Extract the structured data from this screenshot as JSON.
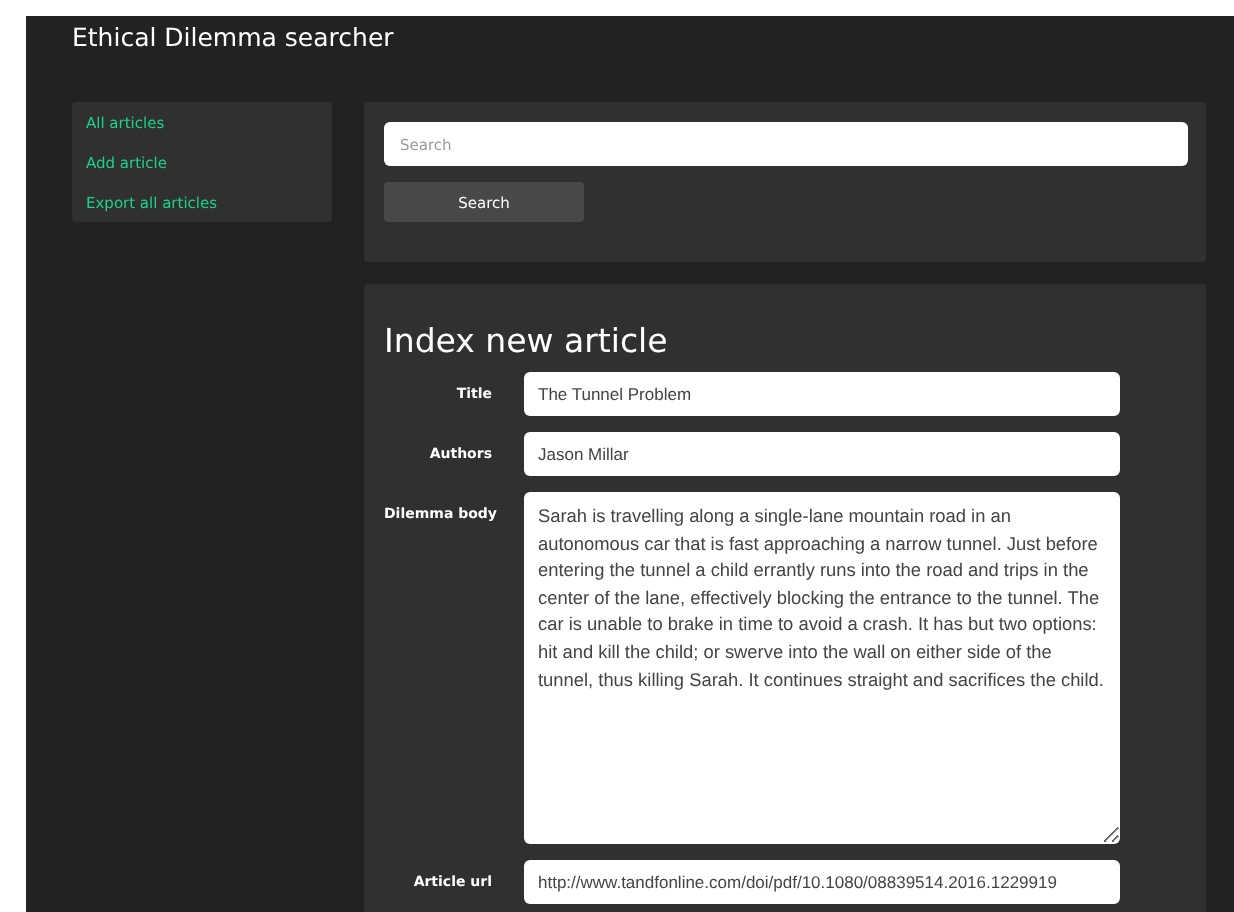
{
  "header": {
    "title": "Ethical Dilemma searcher"
  },
  "sidebar": {
    "items": [
      {
        "label": "All articles"
      },
      {
        "label": "Add article"
      },
      {
        "label": "Export all articles"
      }
    ]
  },
  "search": {
    "placeholder": "Search",
    "button": "Search"
  },
  "form": {
    "heading": "Index new article",
    "fields": [
      {
        "kind": "input",
        "label": "Title",
        "value": "The Tunnel Problem"
      },
      {
        "kind": "input",
        "label": "Authors",
        "value": "Jason Millar"
      },
      {
        "kind": "textarea",
        "label": "Dilemma body",
        "value": "Sarah is travelling along a single-lane mountain road in an autonomous car that is fast approaching a narrow tunnel. Just before entering the tunnel a child errantly runs into the road and trips in the center of the lane, effectively blocking the entrance to the tunnel. The car is unable to brake in time to avoid a crash. It has but two options: hit and kill the child; or swerve into the wall on either side of the tunnel, thus killing Sarah. It continues straight and sacrifices the child."
      },
      {
        "kind": "input",
        "label": "Article url",
        "value": "http://www.tandfonline.com/doi/pdf/10.1080/08839514.2016.1229919"
      }
    ]
  }
}
